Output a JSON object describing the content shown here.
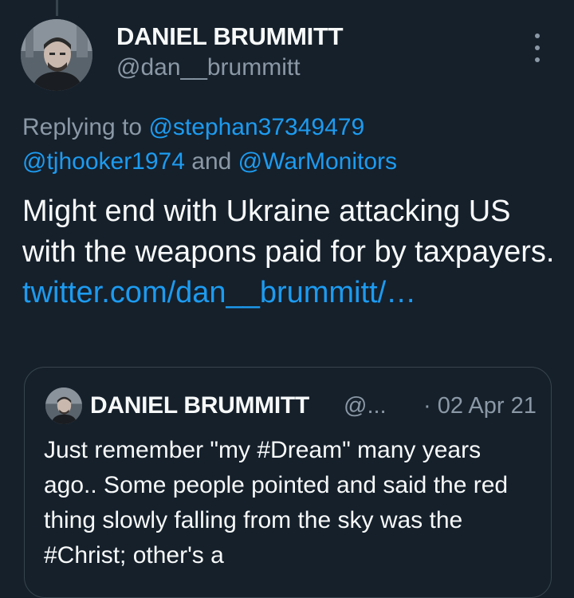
{
  "tweet": {
    "author_name": "DANIEL BRUMMITT",
    "author_handle": "@dan__brummitt",
    "reply_prefix": "Replying to ",
    "reply_mention_1": "@stephan37349479",
    "reply_mention_2": "@tjhooker1974",
    "reply_and": " and ",
    "reply_mention_3": "@WarMonitors",
    "text": "Might end with Ukraine attacking US with the weapons paid for by taxpayers. ",
    "link_text": "twitter.com/​dan__brummitt/…",
    "more_icon": "more-vertical-icon"
  },
  "quote": {
    "author_name": "DANIEL BRUMMITT",
    "author_handle": "@...",
    "date": "· 02 Apr 21",
    "text": "Just remember \"my #Dream\" many years ago.. Some people pointed and said the red thing slowly falling from the sky was the #Christ; other's a"
  },
  "colors": {
    "background": "#15202b",
    "text_primary": "#f7f9f9",
    "text_secondary": "#8b98a5",
    "accent": "#1d9bf0",
    "border": "#38444d"
  }
}
